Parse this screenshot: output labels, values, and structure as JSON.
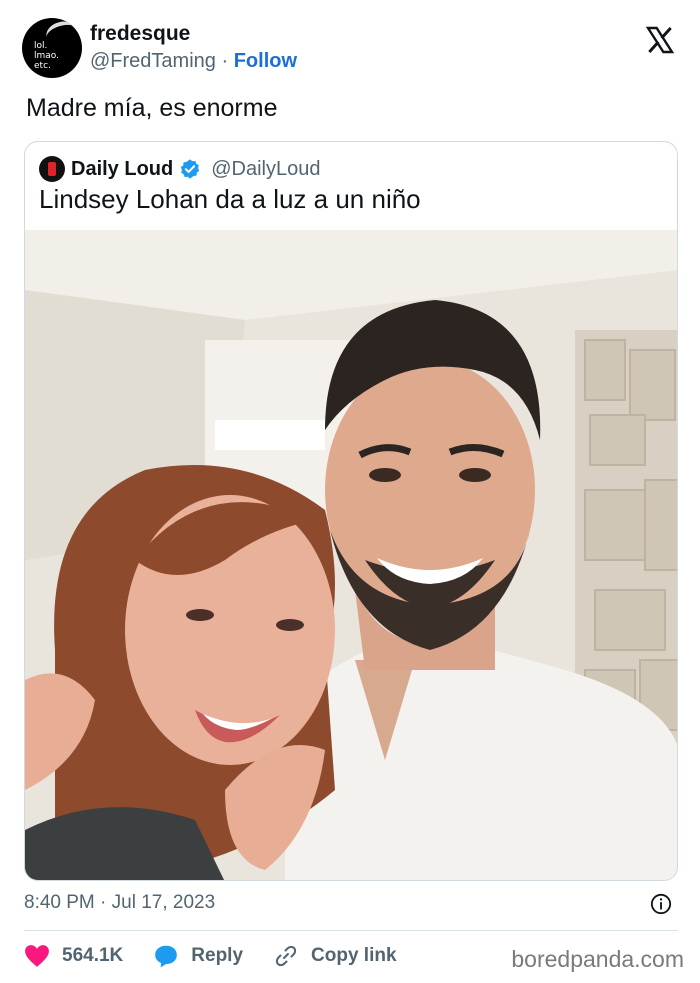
{
  "author": {
    "name": "fredesque",
    "handle": "@FredTaming",
    "separator": "·",
    "follow_label": "Follow",
    "avatar_text": "lol.\nlmao.\netc."
  },
  "tweet": {
    "text": "Madre mía, es enorme",
    "timestamp": "8:40 PM · Jul 17, 2023"
  },
  "quoted": {
    "name": "Daily Loud",
    "handle": "@DailyLoud",
    "text": "Lindsey Lohan da a luz a un niño",
    "verified": true
  },
  "actions": {
    "likes": "564.1K",
    "reply_label": "Reply",
    "copy_label": "Copy link"
  },
  "watermark": "boredpanda.com",
  "colors": {
    "like": "#f91880",
    "reply": "#1d9bf0",
    "follow": "#1d6fd8",
    "verified": "#1d9bf0"
  },
  "icons": [
    "x-logo-icon",
    "verified-badge-icon",
    "info-icon",
    "heart-icon",
    "comment-bubble-icon",
    "link-icon"
  ]
}
